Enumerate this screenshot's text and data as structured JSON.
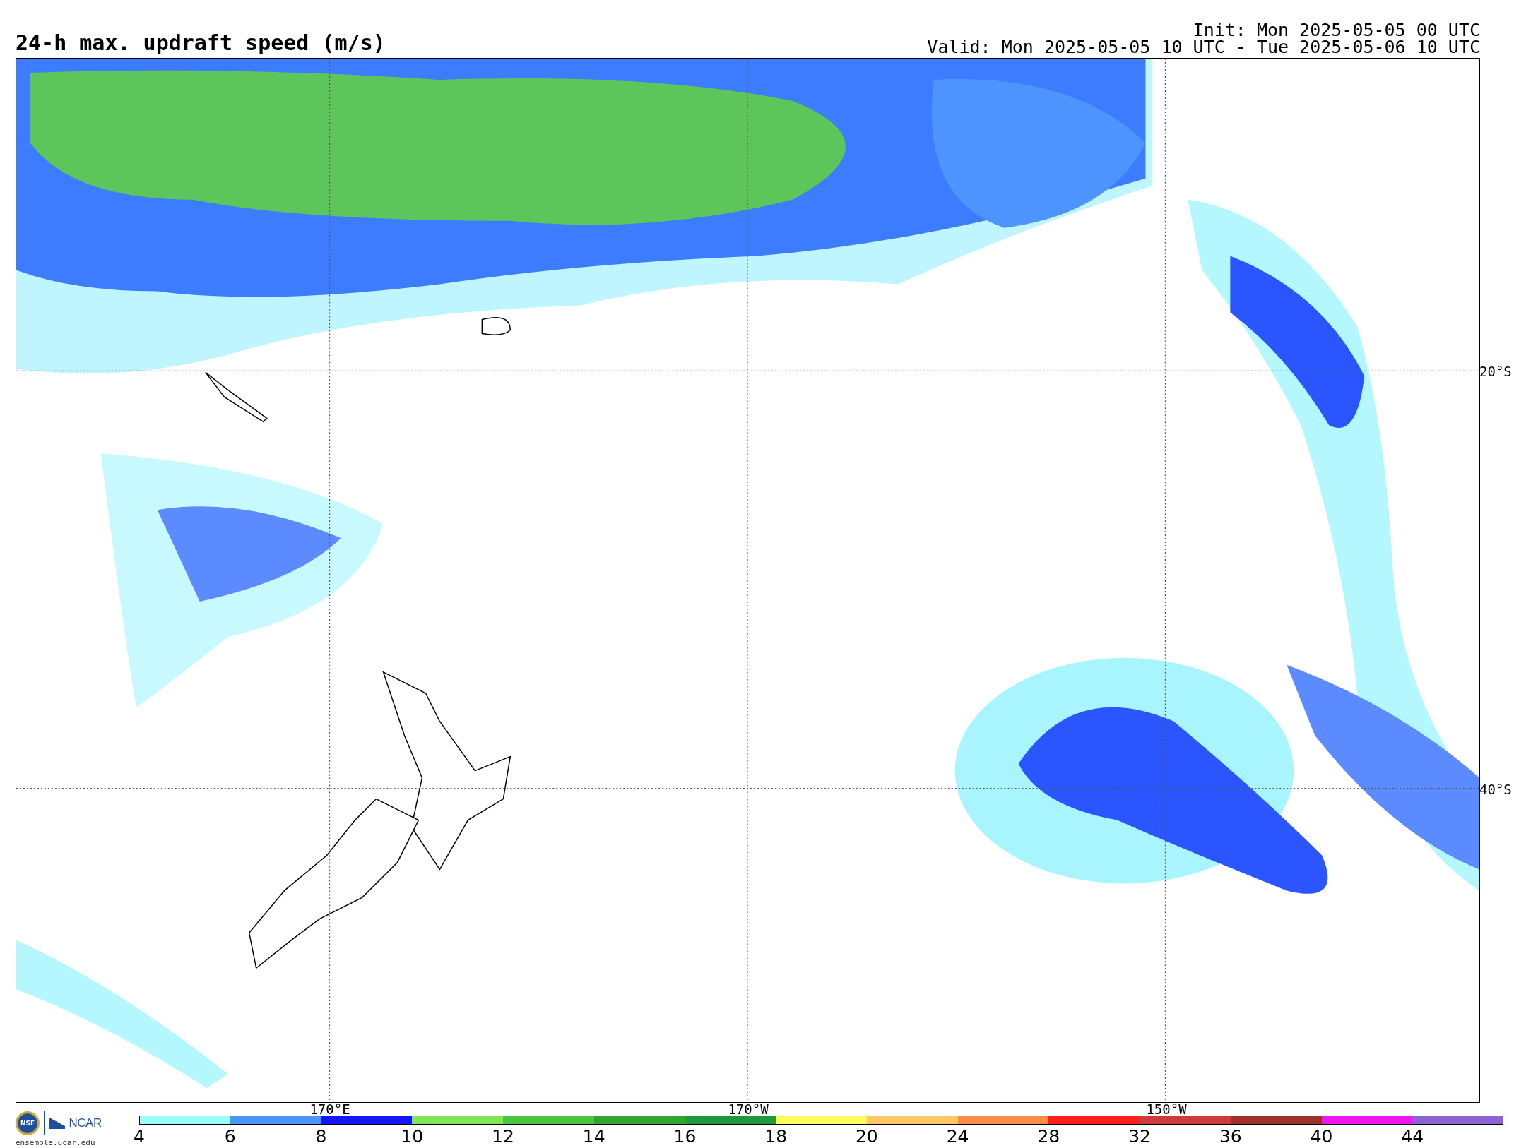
{
  "title": "24-h max. updraft speed (m/s)",
  "init": "Init: Mon 2025-05-05 00 UTC",
  "valid": "Valid: Mon 2025-05-05 10 UTC - Tue 2025-05-06 10 UTC",
  "map": {
    "latitude_labels": [
      {
        "label": "20°S"
      },
      {
        "label": "40°S"
      }
    ],
    "longitude_labels": [
      {
        "label": "170°E"
      },
      {
        "label": "170°W"
      },
      {
        "label": "150°W"
      }
    ]
  },
  "logo": {
    "nsf": "NSF",
    "ncar": "NCAR",
    "url": "ensemble.ucar.edu"
  },
  "colorbar": [
    {
      "label": "4",
      "color": "#99ffff"
    },
    {
      "label": "6",
      "color": "#4d94ff"
    },
    {
      "label": "8",
      "color": "#1414ff"
    },
    {
      "label": "10",
      "color": "#80e654"
    },
    {
      "label": "12",
      "color": "#4cc641"
    },
    {
      "label": "14",
      "color": "#30a630"
    },
    {
      "label": "16",
      "color": "#1e9a3c"
    },
    {
      "label": "18",
      "color": "#ffff5a"
    },
    {
      "label": "20",
      "color": "#ffc864"
    },
    {
      "label": "24",
      "color": "#ff8c46"
    },
    {
      "label": "28",
      "color": "#ff1e1e"
    },
    {
      "label": "32",
      "color": "#cc3c3c"
    },
    {
      "label": "36",
      "color": "#a0302a"
    },
    {
      "label": "40",
      "color": "#f014f0"
    },
    {
      "label": "44",
      "color": "#8c64d2"
    }
  ]
}
